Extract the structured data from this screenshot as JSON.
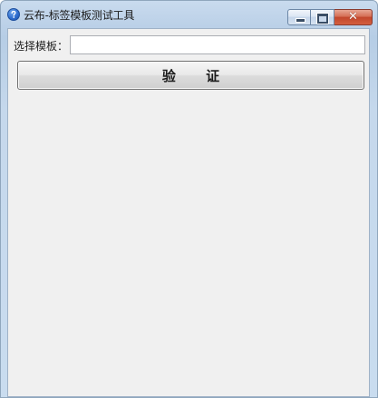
{
  "window": {
    "title": "云布-标签模板测试工具",
    "icon": "help-question-icon",
    "controls": {
      "minimize_icon": "minimize-icon",
      "maximize_icon": "maximize-icon",
      "close_icon": "close-icon",
      "close_glyph": "✕"
    }
  },
  "form": {
    "template_label": "选择模板：",
    "template_value": "",
    "verify_label": "验 证"
  },
  "colors": {
    "close_button": "#c2462c",
    "client_background": "#f0f0f0",
    "frame": "#c9dbee"
  }
}
